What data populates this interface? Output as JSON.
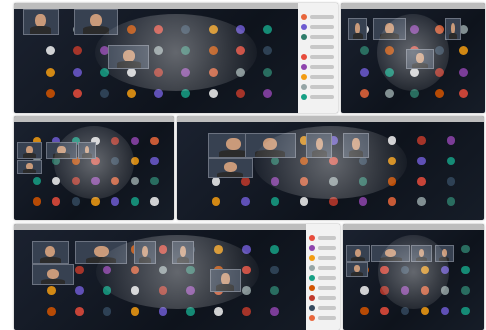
{
  "collage": {
    "title": "",
    "photos": [
      {
        "id": "p1",
        "name": "photo-top-left",
        "participants": 36
      },
      {
        "id": "p2",
        "name": "photo-top-right",
        "participants": 20
      },
      {
        "id": "p3",
        "name": "photo-mid-left",
        "participants": 24
      },
      {
        "id": "p4",
        "name": "photo-mid-right",
        "participants": 24
      },
      {
        "id": "p5",
        "name": "photo-bottom-left",
        "participants": 24
      },
      {
        "id": "p6",
        "name": "photo-bottom-right",
        "participants": 20
      }
    ]
  },
  "colors": {
    "screen_dark": "#141a24",
    "avatar_palette": [
      "#e8663b",
      "#6d5bd0",
      "#2e7d6b",
      "#f2f2f2",
      "#e74c3c",
      "#8e44ad",
      "#f39c12",
      "#95a5a6",
      "#16a085",
      "#d35400",
      "#c0392b",
      "#34495e"
    ]
  }
}
